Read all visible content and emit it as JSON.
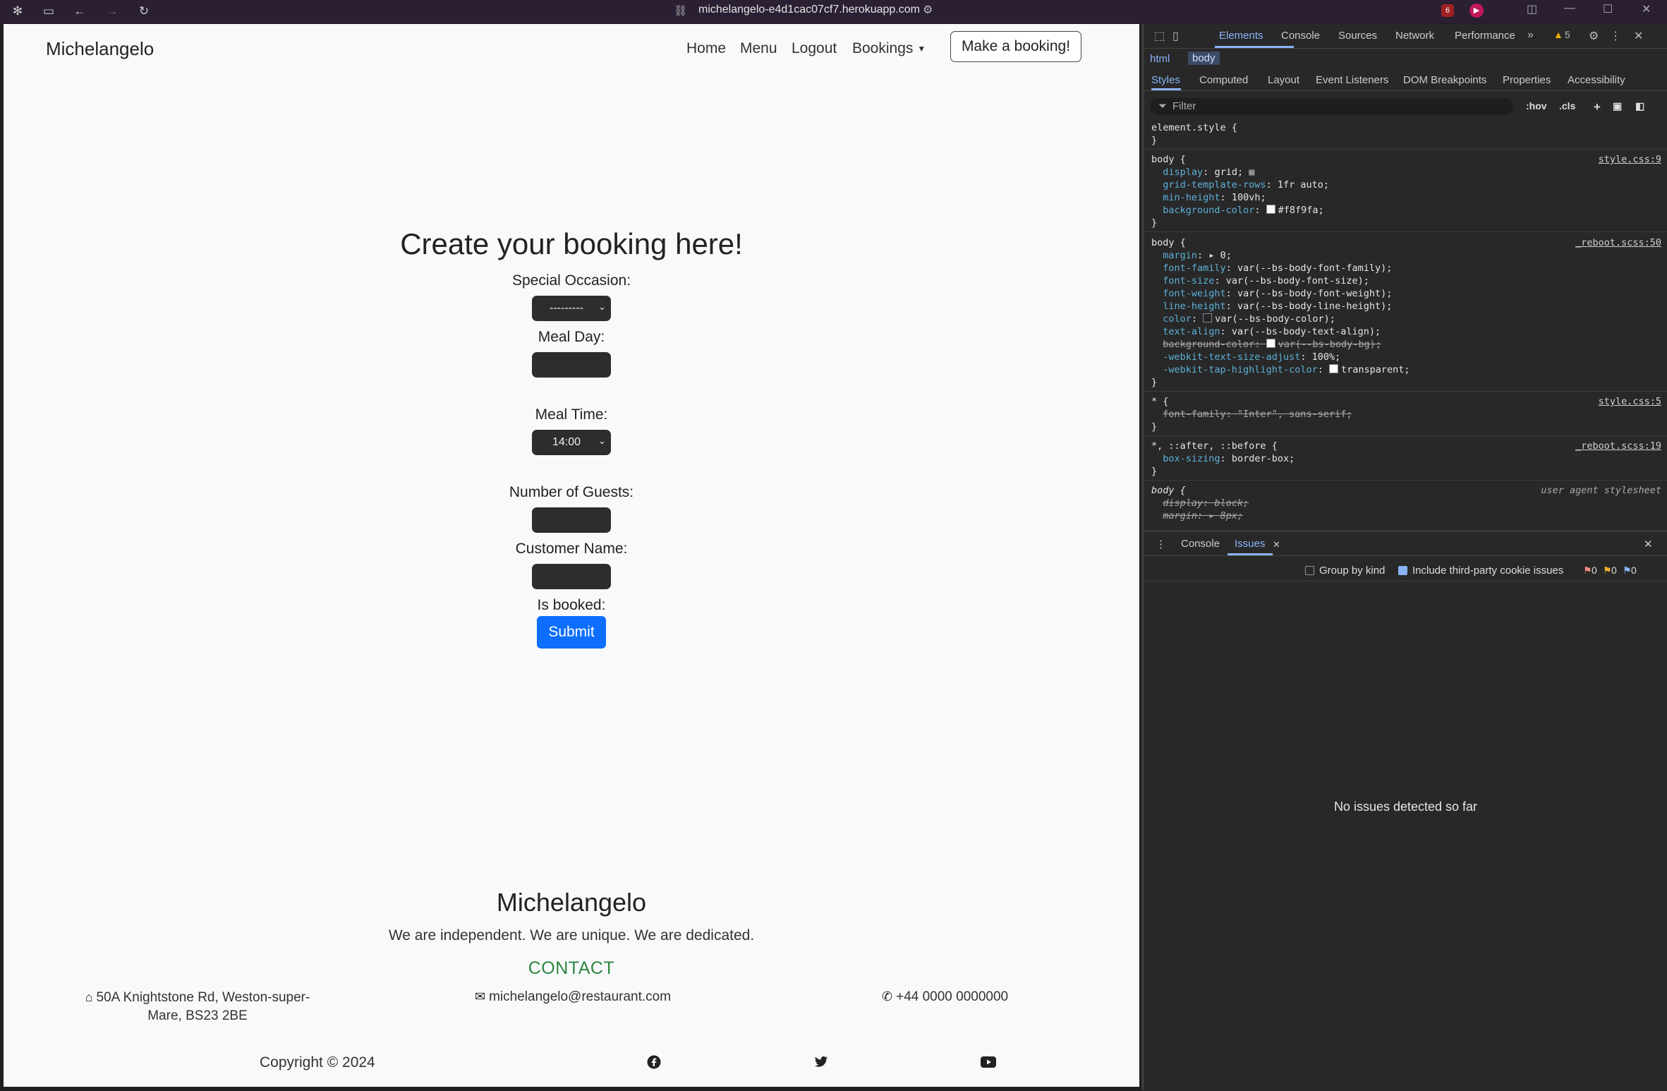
{
  "browser": {
    "url": "michelangelo-e4d1cac07cf7.herokuapp.com",
    "ext_badge": "6"
  },
  "site": {
    "brand": "Michelangelo",
    "nav": {
      "home": "Home",
      "menu": "Menu",
      "logout": "Logout",
      "bookings": "Bookings",
      "make_booking": "Make a booking!"
    },
    "form": {
      "title": "Create your booking here!",
      "occasion_label": "Special Occasion:",
      "occasion_value": "---------",
      "meal_day_label": "Meal Day:",
      "meal_day_value": "",
      "meal_time_label": "Meal Time:",
      "meal_time_value": "14:00",
      "guests_label": "Number of Guests:",
      "guests_value": "",
      "customer_label": "Customer Name:",
      "customer_value": "",
      "is_booked_label": "Is booked:",
      "submit": "Submit"
    },
    "footer": {
      "brand": "Michelangelo",
      "tagline": "We are independent. We are unique. We are dedicated.",
      "contact_heading": "CONTACT",
      "address_line1": "50A Knightstone Rd, Weston-super-",
      "address_line2": "Mare, BS23 2BE",
      "email": "michelangelo@restaurant.com",
      "phone": "+44 0000 0000000",
      "copyright": "Copyright © 2024"
    }
  },
  "devtools": {
    "tabs": [
      "Elements",
      "Console",
      "Sources",
      "Network",
      "Performance"
    ],
    "warnings": "5",
    "breadcrumbs": [
      "html",
      "body"
    ],
    "subtabs": [
      "Styles",
      "Computed",
      "Layout",
      "Event Listeners",
      "DOM Breakpoints",
      "Properties",
      "Accessibility"
    ],
    "filter_placeholder": "Filter",
    "hov": ":hov",
    "cls": ".cls",
    "rules": {
      "element_style": "element.style {",
      "close": "}",
      "body1_sel": "body {",
      "body1_src": "style.css:9",
      "body1_props": [
        {
          "p": "display",
          "v": "grid;"
        },
        {
          "p": "grid-template-rows",
          "v": "1fr auto;"
        },
        {
          "p": "min-height",
          "v": "100vh;"
        },
        {
          "p": "background-color",
          "v": "#f8f9fa;"
        }
      ],
      "body2_sel": "body {",
      "body2_src": "_reboot.scss:50",
      "body2_props": [
        {
          "p": "margin",
          "v": "▸ 0;"
        },
        {
          "p": "font-family",
          "v": "var(--bs-body-font-family);"
        },
        {
          "p": "font-size",
          "v": "var(--bs-body-font-size);"
        },
        {
          "p": "font-weight",
          "v": "var(--bs-body-font-weight);"
        },
        {
          "p": "line-height",
          "v": "var(--bs-body-line-height);"
        },
        {
          "p": "color",
          "v": "var(--bs-body-color);"
        },
        {
          "p": "text-align",
          "v": "var(--bs-body-text-align);"
        },
        {
          "p": "background-color",
          "v": "var(--bs-body-bg);"
        },
        {
          "p": "-webkit-text-size-adjust",
          "v": "100%;"
        },
        {
          "p": "-webkit-tap-highlight-color",
          "v": "transparent;"
        }
      ],
      "star_sel": "* {",
      "star_src": "style.css:5",
      "star_prop": "font-family: \"Inter\", sans-serif;",
      "box_sel": "*, ::after, ::before {",
      "box_src": "_reboot.scss:19",
      "box_prop": {
        "p": "box-sizing",
        "v": "border-box;"
      },
      "ua_sel": "body {",
      "ua_src": "user agent stylesheet",
      "ua_props": [
        "display: block;",
        "margin: ▸ 8px;"
      ]
    },
    "drawer": {
      "tabs": [
        "Console",
        "Issues"
      ],
      "group_by_kind": "Group by kind",
      "third_party": "Include third-party cookie issues",
      "counts": [
        "0",
        "0",
        "0"
      ],
      "empty": "No issues detected so far"
    }
  }
}
